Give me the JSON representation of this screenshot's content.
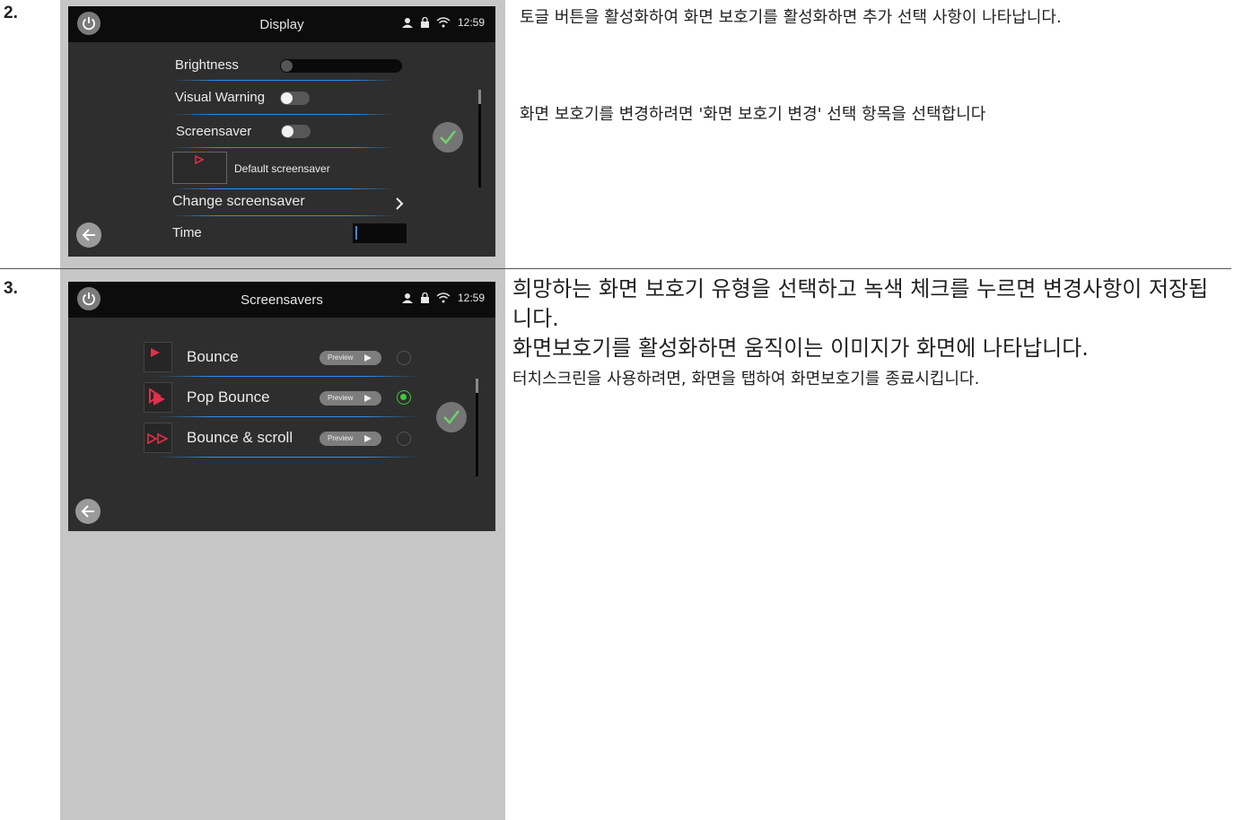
{
  "steps": [
    {
      "number": "2.",
      "screen": {
        "title": "Display",
        "time": "12:59",
        "rows": {
          "brightness_label": "Brightness",
          "visual_warning_label": "Visual Warning",
          "screensaver_label": "Screensaver",
          "default_screensaver_label": "Default screensaver",
          "change_screensaver_label": "Change screensaver",
          "time_label": "Time"
        },
        "brightness_level": 0,
        "visual_warning_on": false,
        "screensaver_on": false
      },
      "description": {
        "para1": "토글 버튼을 활성화하여 화면 보호기를 활성화하면 추가 선택 사항이 나타납니다.",
        "para2": "화면 보호기를 변경하려면 '화면 보호기 변경' 선택 항목을 선택합니다"
      }
    },
    {
      "number": "3.",
      "screen": {
        "title": "Screensavers",
        "time": "12:59",
        "options": [
          {
            "label": "Bounce",
            "preview_label": "Preview",
            "selected": false
          },
          {
            "label": "Pop Bounce",
            "preview_label": "Preview",
            "selected": true
          },
          {
            "label": "Bounce & scroll",
            "preview_label": "Preview",
            "selected": false
          }
        ]
      },
      "description": {
        "para1": "희망하는 화면 보호기 유형을 선택하고 녹색 체크를 누르면 변경사항이 저장됩니다.",
        "para2": "화면보호기를 활성화하면 움직이는 이미지가 화면에 나타납니다.",
        "para3": "터치스크린을 사용하려면, 화면을 탭하여 화면보호기를 종료시킵니다."
      }
    }
  ],
  "colors": {
    "accent_blue": "#2f8fe6",
    "selected_green": "#3ec93e",
    "screen_bg": "#2e2e2e",
    "status_bar": "#0c0c0c"
  },
  "icons": [
    "power-icon",
    "user-icon",
    "lock-icon",
    "wifi-icon",
    "back-arrow-icon",
    "confirm-check-icon",
    "chevron-right-icon",
    "play-icon",
    "screensaver-thumbnail-icon"
  ]
}
